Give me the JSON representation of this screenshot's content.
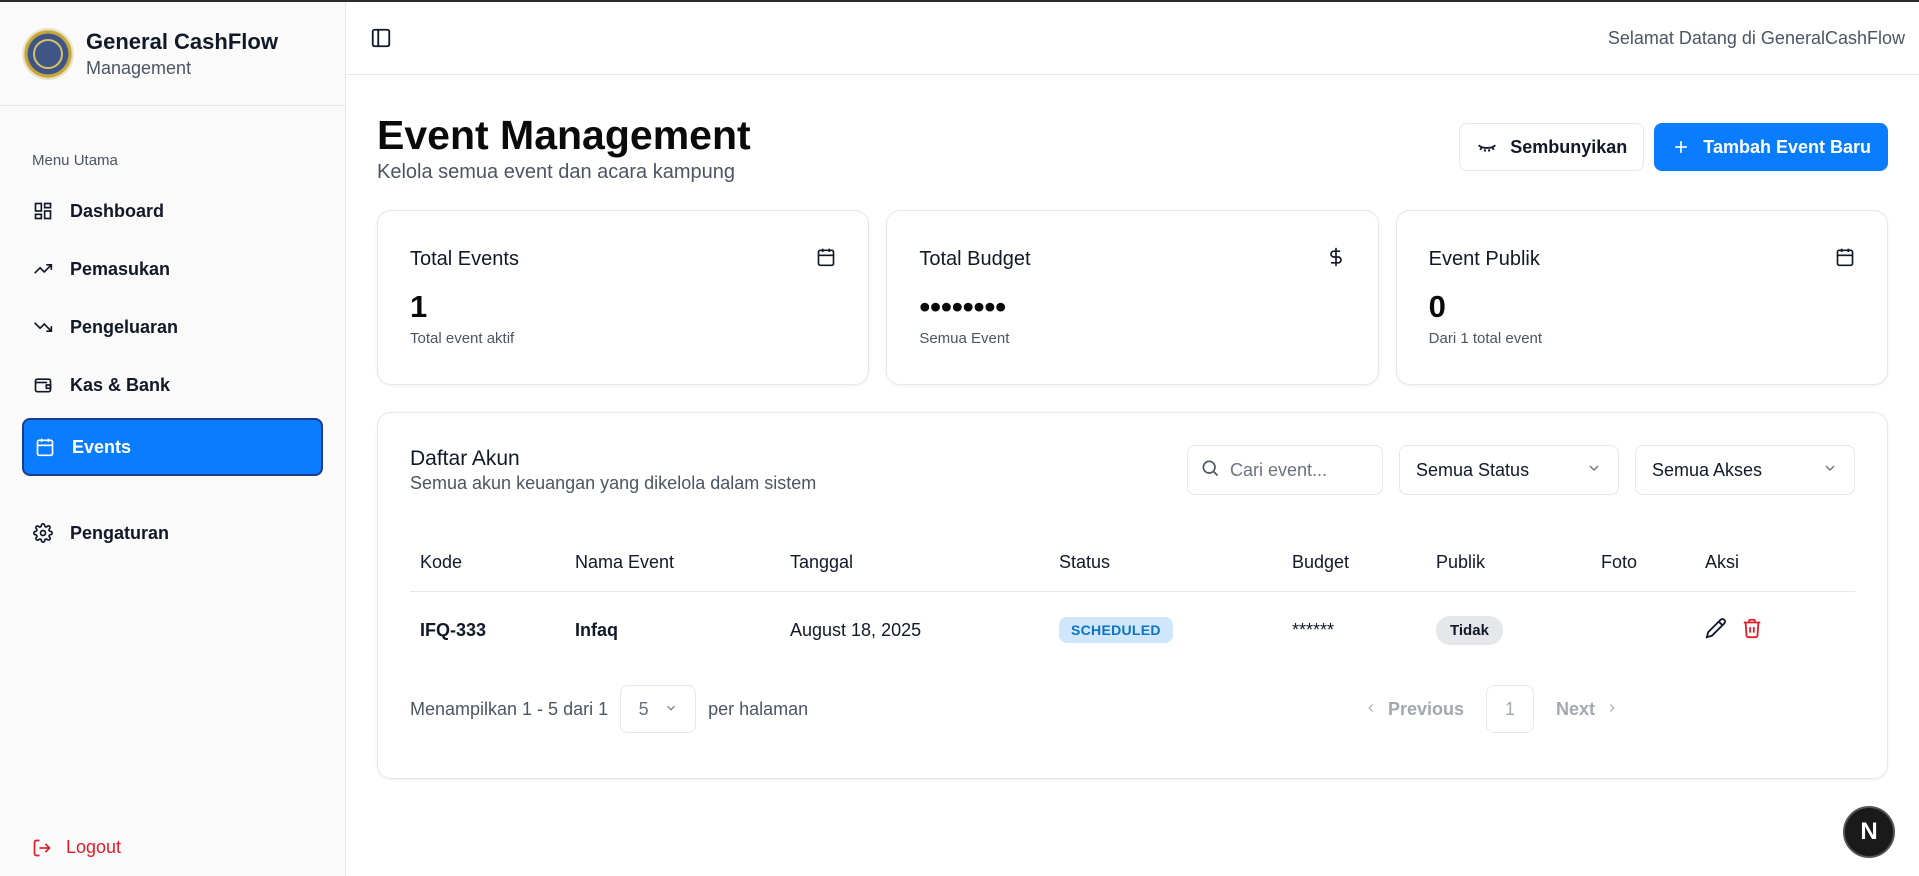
{
  "brand": {
    "title": "General CashFlow",
    "subtitle": "Management"
  },
  "sidebar": {
    "menu_label": "Menu Utama",
    "items": [
      {
        "label": "Dashboard",
        "icon": "dashboard-icon"
      },
      {
        "label": "Pemasukan",
        "icon": "trending-up-icon"
      },
      {
        "label": "Pengeluaran",
        "icon": "trending-down-icon"
      },
      {
        "label": "Kas & Bank",
        "icon": "wallet-icon"
      },
      {
        "label": "Events",
        "icon": "calendar-icon",
        "active": true
      }
    ],
    "settings_label": "Pengaturan",
    "logout_label": "Logout"
  },
  "topbar": {
    "welcome": "Selamat Datang di GeneralCashFlow"
  },
  "page": {
    "title": "Event Management",
    "subtitle": "Kelola semua event dan acara kampung",
    "hide_label": "Sembunyikan",
    "add_label": "Tambah Event Baru"
  },
  "cards": [
    {
      "title": "Total Events",
      "value": "1",
      "note": "Total event aktif",
      "icon": "calendar-icon"
    },
    {
      "title": "Total Budget",
      "value": "••••••••",
      "note": "Semua Event",
      "icon": "dollar-icon"
    },
    {
      "title": "Event Publik",
      "value": "0",
      "note": "Dari 1 total event",
      "icon": "calendar-icon"
    }
  ],
  "panel": {
    "title": "Daftar Akun",
    "subtitle": "Semua akun keuangan yang dikelola dalam sistem",
    "search_placeholder": "Cari event...",
    "status_filter": "Semua Status",
    "access_filter": "Semua Akses"
  },
  "table": {
    "headers": [
      "Kode",
      "Nama Event",
      "Tanggal",
      "Status",
      "Budget",
      "Publik",
      "Foto",
      "Aksi"
    ],
    "rows": [
      {
        "kode": "IFQ-333",
        "nama": "Infaq",
        "tanggal": "August 18, 2025",
        "status": "SCHEDULED",
        "budget": "******",
        "publik": "Tidak",
        "foto": ""
      }
    ]
  },
  "pagination": {
    "showing": "Menampilkan 1 - 5 dari 1",
    "page_size": "5",
    "per_page": "per halaman",
    "previous": "Previous",
    "current": "1",
    "next": "Next"
  },
  "fab_label": "N",
  "colors": {
    "accent": "#0a7cff",
    "danger": "#e11d2a",
    "status_badge_bg": "#cfe6fb"
  }
}
